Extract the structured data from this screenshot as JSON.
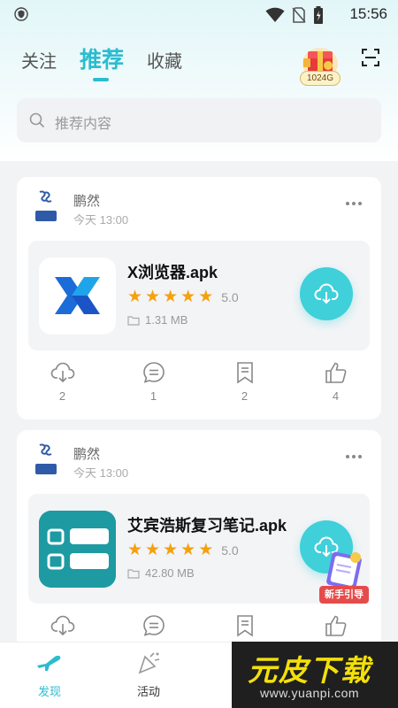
{
  "status_bar": {
    "time": "15:56"
  },
  "tabs": [
    {
      "label": "关注"
    },
    {
      "label": "推荐"
    },
    {
      "label": "收藏"
    }
  ],
  "gift": {
    "label": "1024G"
  },
  "search": {
    "placeholder": "推荐内容"
  },
  "posts": [
    {
      "author": "鹏然",
      "time": "今天 13:00",
      "apk": {
        "name": "X浏览器.apk",
        "rating": "5.0",
        "size": "1.31 MB"
      },
      "actions": {
        "download": "2",
        "comment": "1",
        "bookmark": "2",
        "like": "4"
      }
    },
    {
      "author": "鹏然",
      "time": "今天 13:00",
      "apk": {
        "name": "艾宾浩斯复习笔记.apk",
        "rating": "5.0",
        "size": "42.80 MB"
      },
      "actions": {}
    }
  ],
  "newbie_guide": {
    "label": "新手引导"
  },
  "bottom_nav": [
    {
      "label": "发现"
    },
    {
      "label": "活动"
    }
  ],
  "watermark": {
    "main": "元皮下载",
    "sub": "www.yuanpi.com"
  },
  "colors": {
    "accent": "#2bbcd0",
    "download_button": "#3fd0da",
    "star": "#f5a10e"
  }
}
